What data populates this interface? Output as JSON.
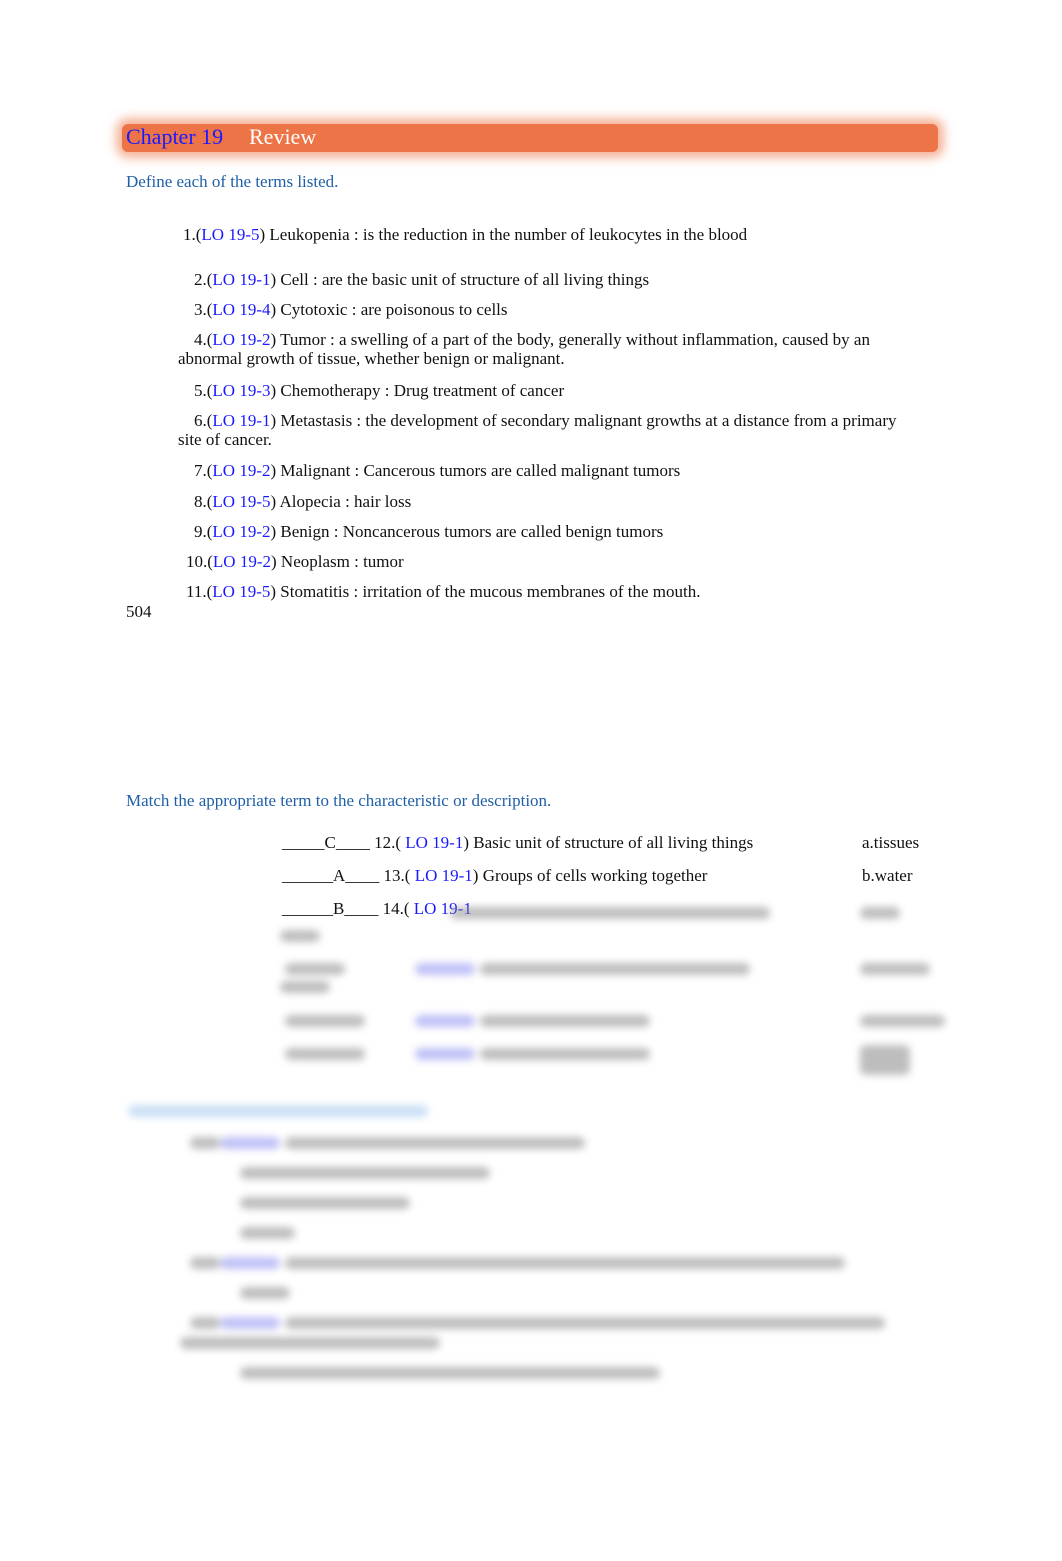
{
  "header": {
    "chapter": "Chapter 19",
    "title": "Review"
  },
  "section1": {
    "instruction": "Define each of the terms listed.",
    "items": [
      {
        "num": "1.(",
        "lo": "LO 19-5",
        "text": ") Leukopenia : is the reduction in the number of leukocytes in the blood"
      },
      {
        "num": "2.(",
        "lo": "LO 19-1",
        "text": ") Cell : are the basic unit of structure of all living things"
      },
      {
        "num": "3.(",
        "lo": "LO 19-4",
        "text": ") Cytotoxic : are poisonous to cells"
      },
      {
        "num": "4.(",
        "lo": "LO 19-2",
        "text": ") Tumor : a swelling of a part of the body, generally without inflammation, caused by an",
        "cont": "abnormal growth of tissue, whether benign or malignant."
      },
      {
        "num": "5.(",
        "lo": "LO 19-3",
        "text": ") Chemotherapy : Drug treatment of cancer"
      },
      {
        "num": "6.(",
        "lo": "LO 19-1",
        "text": ") Metastasis : the development of secondary malignant growths at a distance from a primary",
        "cont": "site of cancer."
      },
      {
        "num": "7.(",
        "lo": "LO 19-2",
        "text": ") Malignant : Cancerous tumors are called malignant tumors"
      },
      {
        "num": "8.(",
        "lo": "LO 19-5",
        "text": ") Alopecia : hair loss"
      },
      {
        "num": "9.(",
        "lo": "LO 19-2",
        "text": ") Benign : Noncancerous tumors are called benign tumors"
      },
      {
        "num": "10.(",
        "lo": "LO 19-2",
        "text": ") Neoplasm : tumor"
      },
      {
        "num": "11.(",
        "lo": "LO 19-5",
        "text": ") Stomatitis : irritation of the mucous membranes of the mouth."
      }
    ],
    "page_number": "504"
  },
  "section2": {
    "instruction": "Match the appropriate term to the characteristic or description.",
    "items": [
      {
        "answer": "_____C____ 12.( ",
        "lo": "LO 19-1",
        "text": ") Basic unit of structure of all living things",
        "option": "a.tissues"
      },
      {
        "answer": "______A____ 13.( ",
        "lo": "LO 19-1",
        "text": ") Groups of cells working together",
        "option": "b.water"
      },
      {
        "answer": "______B____ 14.( ",
        "lo": "LO 19-1",
        "text": "",
        "option": ""
      }
    ]
  }
}
